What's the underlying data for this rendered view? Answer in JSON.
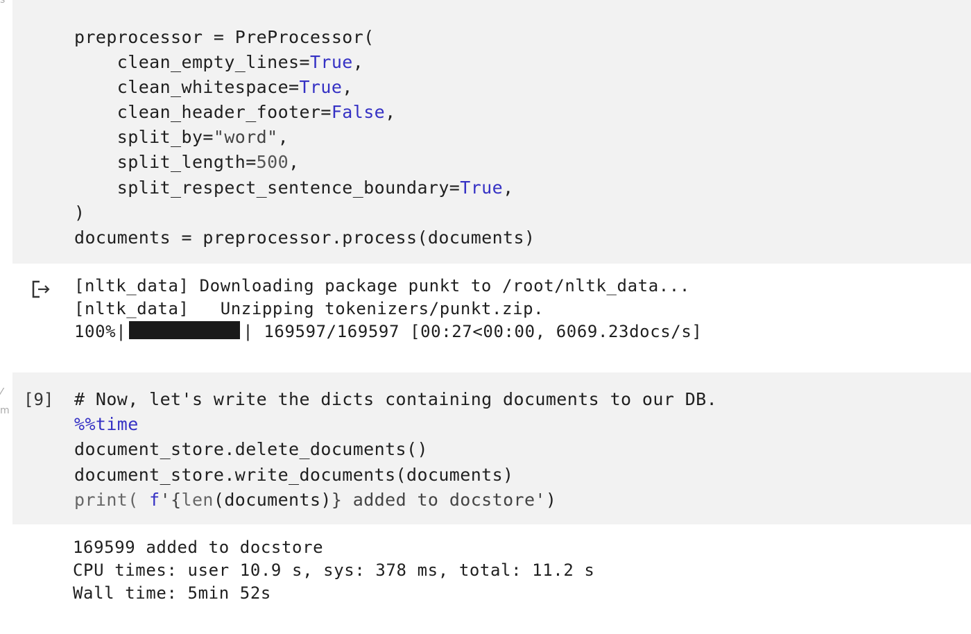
{
  "cell_1": {
    "line_1": "preprocessor = PreProcessor(",
    "line_2a": "    clean_empty_lines=",
    "line_2b": "True",
    "line_2c": ",",
    "line_3a": "    clean_whitespace=",
    "line_3b": "True",
    "line_3c": ",",
    "line_4a": "    clean_header_footer=",
    "line_4b": "False",
    "line_4c": ",",
    "line_5a": "    split_by=",
    "line_5b": "\"word\"",
    "line_5c": ",",
    "line_6a": "    split_length=",
    "line_6b": "500",
    "line_6c": ",",
    "line_7a": "    split_respect_sentence_boundary=",
    "line_7b": "True",
    "line_7c": ",",
    "line_8": ")",
    "line_9": "documents = preprocessor.process(documents)"
  },
  "output_1": {
    "line_1": "[nltk_data] Downloading package punkt to /root/nltk_data...",
    "line_2": "[nltk_data]   Unzipping tokenizers/punkt.zip.",
    "progress_percent": "100%",
    "progress_fraction": 1.0,
    "progress_tail": "169597/169597 [00:27<00:00, 6069.23docs/s]"
  },
  "cell_2": {
    "exec_count": "[9]",
    "line_1": "# Now, let's write the dicts containing documents to our DB.",
    "line_2": "%%time",
    "line_3": "document_store.delete_documents()",
    "line_4": "document_store.write_documents(documents)",
    "line_5a": "print(",
    "line_5b": " f",
    "line_5c": "'{",
    "line_5d": "len",
    "line_5e": "(documents)",
    "line_5f": "} added to docstore'",
    "line_5g": ")"
  },
  "output_2": {
    "line_1": "169599 added to docstore",
    "line_2": "CPU times: user 10.9 s, sys: 378 ms, total: 11.2 s",
    "line_3": "Wall time: 5min 52s"
  },
  "icons": {
    "output": "output-arrow-icon"
  },
  "colors": {
    "cell_background": "#f2f2f2",
    "keyword": "#3531c4"
  }
}
